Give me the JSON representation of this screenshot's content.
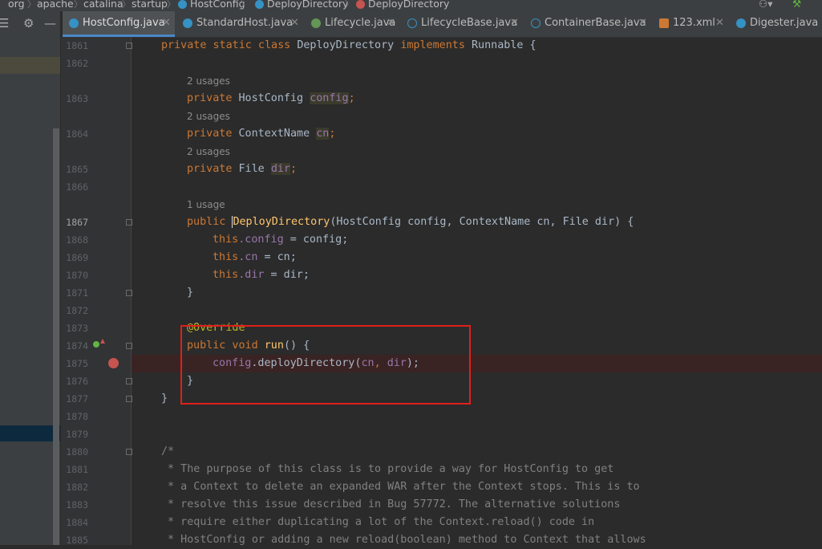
{
  "breadcrumbs": [
    "org",
    "apache",
    "catalina",
    "startup",
    "HostConfig",
    "DeployDirectory",
    "DeployDirectory"
  ],
  "tabs": [
    {
      "label": "HostConfig.java",
      "active": true
    },
    {
      "label": "StandardHost.java"
    },
    {
      "label": "Lifecycle.java"
    },
    {
      "label": "LifecycleBase.java"
    },
    {
      "label": "ContainerBase.java"
    },
    {
      "label": "123.xml"
    },
    {
      "label": "Digester.java"
    }
  ],
  "hints": {
    "h1863": "2 usages",
    "h1864": "2 usages",
    "h1865": "2 usages",
    "h1867": "1 usage"
  },
  "lines": {
    "l1861": "1861",
    "l1862": "1862",
    "l1863": "1863",
    "l1864": "1864",
    "l1865": "1865",
    "l1866": "1866",
    "l1867": "1867",
    "l1868": "1868",
    "l1869": "1869",
    "l1870": "1870",
    "l1871": "1871",
    "l1872": "1872",
    "l1873": "1873",
    "l1874": "1874",
    "l1875": "1875",
    "l1876": "1876",
    "l1877": "1877",
    "l1878": "1878",
    "l1879": "1879",
    "l1880": "1880",
    "l1881": "1881",
    "l1882": "1882",
    "l1883": "1883",
    "l1884": "1884",
    "l1885": "1885"
  },
  "code": {
    "c1861a": "private static class ",
    "c1861b": "DeployDirectory ",
    "c1861c": "implements ",
    "c1861d": "Runnable {",
    "c1863a": "private ",
    "c1863b": "HostConfig ",
    "c1863c": "config",
    "c1863d": ";",
    "c1864a": "private ",
    "c1864b": "ContextName ",
    "c1864c": "cn",
    "c1864d": ";",
    "c1865a": "private ",
    "c1865b": "File ",
    "c1865c": "dir",
    "c1865d": ";",
    "c1867a": "public ",
    "c1867b": "DeployDirectory",
    "c1867c": "(HostConfig config, ContextName cn, File dir) {",
    "c1868a": "this",
    "c1868b": ".config",
    "c1868c": " = config;",
    "c1869a": "this",
    "c1869b": ".cn",
    "c1869c": " = cn;",
    "c1870a": "this",
    "c1870b": ".dir",
    "c1870c": " = dir;",
    "c1871": "}",
    "c1873": "@Override",
    "c1874a": "public void ",
    "c1874b": "run",
    "c1874c": "() {",
    "c1875a": "config",
    "c1875b": ".deployDirectory(",
    "c1875c": "cn",
    "c1875d": ", ",
    "c1875e": "dir",
    "c1875f": ");",
    "c1876": "}",
    "c1877": "}",
    "c1880": "/*",
    "c1881": " * The purpose of this class is to provide a way for HostConfig to get",
    "c1882": " * a Context to delete an expanded WAR after the Context stops. This is to",
    "c1883": " * resolve this issue described in Bug 57772. The alternative solutions",
    "c1884": " * require either duplicating a lot of the Context.reload() code in",
    "c1885": " * HostConfig or adding a new reload(boolean) method to Context that allows"
  },
  "colors": {
    "keyword": "#cc7832",
    "method": "#ffc66d",
    "field": "#9876aa",
    "annotation": "#bbb529",
    "comment": "#808080",
    "highlight_box": "#e0201b"
  },
  "icons": [
    "settings-gear-icon",
    "collapse-icon",
    "user-icon",
    "hammer-icon",
    "breakpoint-icon",
    "override-icon"
  ]
}
